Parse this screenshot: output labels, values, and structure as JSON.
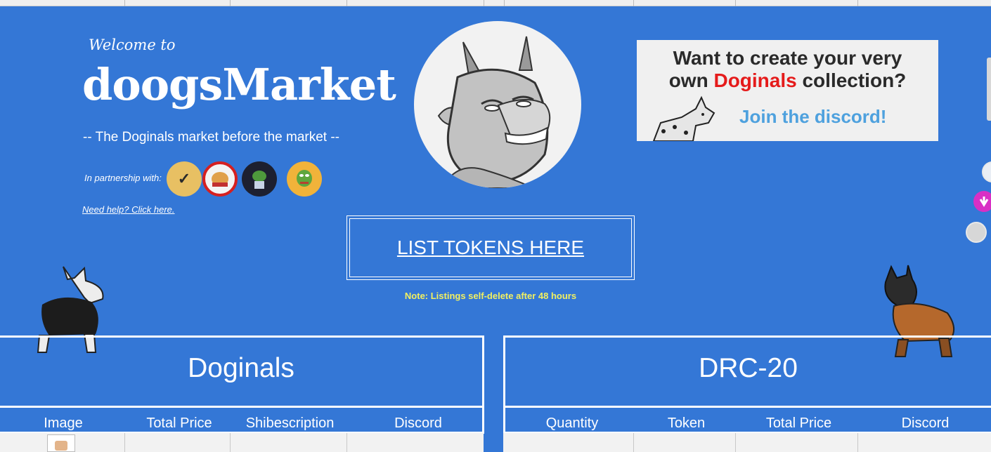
{
  "hero": {
    "welcome": "Welcome to",
    "brand": "doogsMarket",
    "tagline": "-- The Doginals market before the market --",
    "partner_label": "In partnership with:",
    "help_link": "Need help? Click here."
  },
  "partners": [
    {
      "icon": "checkmark-doge-logo"
    },
    {
      "icon": "dogepay-logo"
    },
    {
      "icon": "pepe-doge-logo"
    },
    {
      "icon": "pepe-logo"
    }
  ],
  "promo": {
    "line1_before": "Want to create your very",
    "line2_before": "own ",
    "line2_highlight": "Doginals",
    "line2_after": " collection?",
    "cta": "Join the discord!"
  },
  "list_button": "LIST TOKENS HERE",
  "note": "Note: Listings self-delete after 48 hours",
  "doginals_panel": {
    "title": "Doginals",
    "columns": [
      "Image",
      "Total Price",
      "Shibescription",
      "Discord"
    ]
  },
  "drc20_panel": {
    "title": "DRC-20",
    "columns": [
      "Quantity",
      "Token",
      "Total Price",
      "Discord"
    ]
  },
  "side_icons": [
    "goat-avatar-icon",
    "pink-hand-icon",
    "goat-small-icon"
  ],
  "colors": {
    "background": "#3477d6",
    "note": "#f2f060",
    "promo_highlight": "#e51b1b",
    "promo_cta": "#4ea1de"
  }
}
